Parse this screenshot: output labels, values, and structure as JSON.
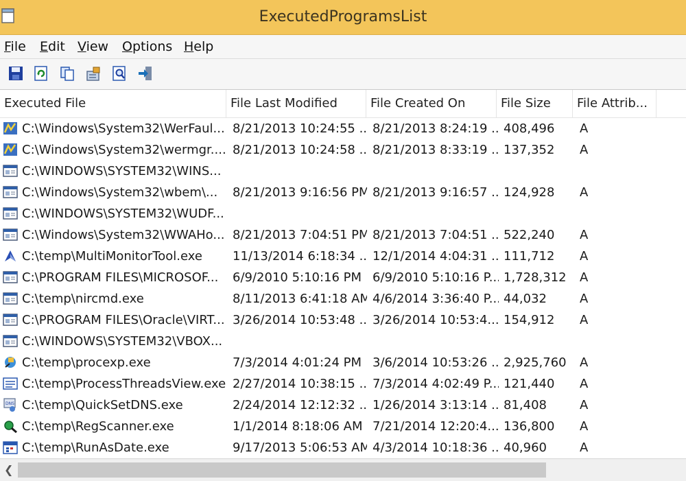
{
  "window": {
    "title": "ExecutedProgramsList"
  },
  "menu": [
    {
      "label": "File"
    },
    {
      "label": "Edit"
    },
    {
      "label": "View"
    },
    {
      "label": "Options"
    },
    {
      "label": "Help"
    }
  ],
  "toolbar": [
    {
      "icon": "save-icon"
    },
    {
      "icon": "refresh-icon"
    },
    {
      "icon": "copy-icon"
    },
    {
      "icon": "properties-icon"
    },
    {
      "icon": "find-icon"
    },
    {
      "icon": "exit-icon"
    }
  ],
  "columns": [
    "Executed File",
    "File Last Modified",
    "File Created On",
    "File Size",
    "File Attrib..."
  ],
  "rows": [
    {
      "icon": "werfault-app-icon",
      "file": "C:\\Windows\\System32\\WerFaul...",
      "modified": "8/21/2013 10:24:55 ...",
      "created": "8/21/2013 8:24:19 ...",
      "size": "408,496",
      "attr": "A"
    },
    {
      "icon": "wermgr-app-icon",
      "file": "C:\\Windows\\System32\\wermgr....",
      "modified": "8/21/2013 10:24:58 ...",
      "created": "8/21/2013 8:33:19 ...",
      "size": "137,352",
      "attr": "A"
    },
    {
      "icon": "generic-exe-icon",
      "file": "C:\\WINDOWS\\SYSTEM32\\WINS...",
      "modified": "",
      "created": "",
      "size": "",
      "attr": ""
    },
    {
      "icon": "generic-exe-icon",
      "file": "C:\\Windows\\System32\\wbem\\...",
      "modified": "8/21/2013 9:16:56 PM",
      "created": "8/21/2013 9:16:57 ...",
      "size": "124,928",
      "attr": "A"
    },
    {
      "icon": "generic-exe-icon",
      "file": "C:\\WINDOWS\\SYSTEM32\\WUDF...",
      "modified": "",
      "created": "",
      "size": "",
      "attr": ""
    },
    {
      "icon": "generic-exe-icon",
      "file": "C:\\Windows\\System32\\WWAHo...",
      "modified": "8/21/2013 7:04:51 PM",
      "created": "8/21/2013 7:04:51 ...",
      "size": "522,240",
      "attr": "A"
    },
    {
      "icon": "multimonitor-app-icon",
      "file": "C:\\temp\\MultiMonitorTool.exe",
      "modified": "11/13/2014 6:18:34 ...",
      "created": "12/1/2014 4:04:31 ...",
      "size": "111,712",
      "attr": "A"
    },
    {
      "icon": "generic-exe-icon",
      "file": "C:\\PROGRAM FILES\\MICROSOF...",
      "modified": "6/9/2010 5:10:16 PM",
      "created": "6/9/2010 5:10:16 P...",
      "size": "1,728,312",
      "attr": "A"
    },
    {
      "icon": "generic-exe-icon",
      "file": "C:\\temp\\nircmd.exe",
      "modified": "8/11/2013 6:41:18 AM",
      "created": "4/6/2014 3:36:40 P...",
      "size": "44,032",
      "attr": "A"
    },
    {
      "icon": "generic-exe-icon",
      "file": "C:\\PROGRAM FILES\\Oracle\\VIRT...",
      "modified": "3/26/2014 10:53:48 ...",
      "created": "3/26/2014 10:53:4...",
      "size": "154,912",
      "attr": "A"
    },
    {
      "icon": "generic-exe-icon",
      "file": "C:\\WINDOWS\\SYSTEM32\\VBOX...",
      "modified": "",
      "created": "",
      "size": "",
      "attr": ""
    },
    {
      "icon": "procexp-app-icon",
      "file": "C:\\temp\\procexp.exe",
      "modified": "7/3/2014 4:01:24 PM",
      "created": "3/6/2014 10:53:26 ...",
      "size": "2,925,760",
      "attr": "A"
    },
    {
      "icon": "processthreads-app-icon",
      "file": "C:\\temp\\ProcessThreadsView.exe",
      "modified": "2/27/2014 10:38:15 ...",
      "created": "7/3/2014 4:02:49 P...",
      "size": "121,440",
      "attr": "A"
    },
    {
      "icon": "quicksetdns-app-icon",
      "file": "C:\\temp\\QuickSetDNS.exe",
      "modified": "2/24/2014 12:12:32 ...",
      "created": "1/26/2014 3:13:14 ...",
      "size": "81,408",
      "attr": "A"
    },
    {
      "icon": "regscanner-app-icon",
      "file": "C:\\temp\\RegScanner.exe",
      "modified": "1/1/2014 8:18:06 AM",
      "created": "7/21/2014 12:20:4...",
      "size": "136,800",
      "attr": "A"
    },
    {
      "icon": "runasdate-app-icon",
      "file": "C:\\temp\\RunAsDate.exe",
      "modified": "9/17/2013 5:06:53 AM",
      "created": "4/3/2014 10:18:36 ...",
      "size": "40,960",
      "attr": "A"
    }
  ]
}
